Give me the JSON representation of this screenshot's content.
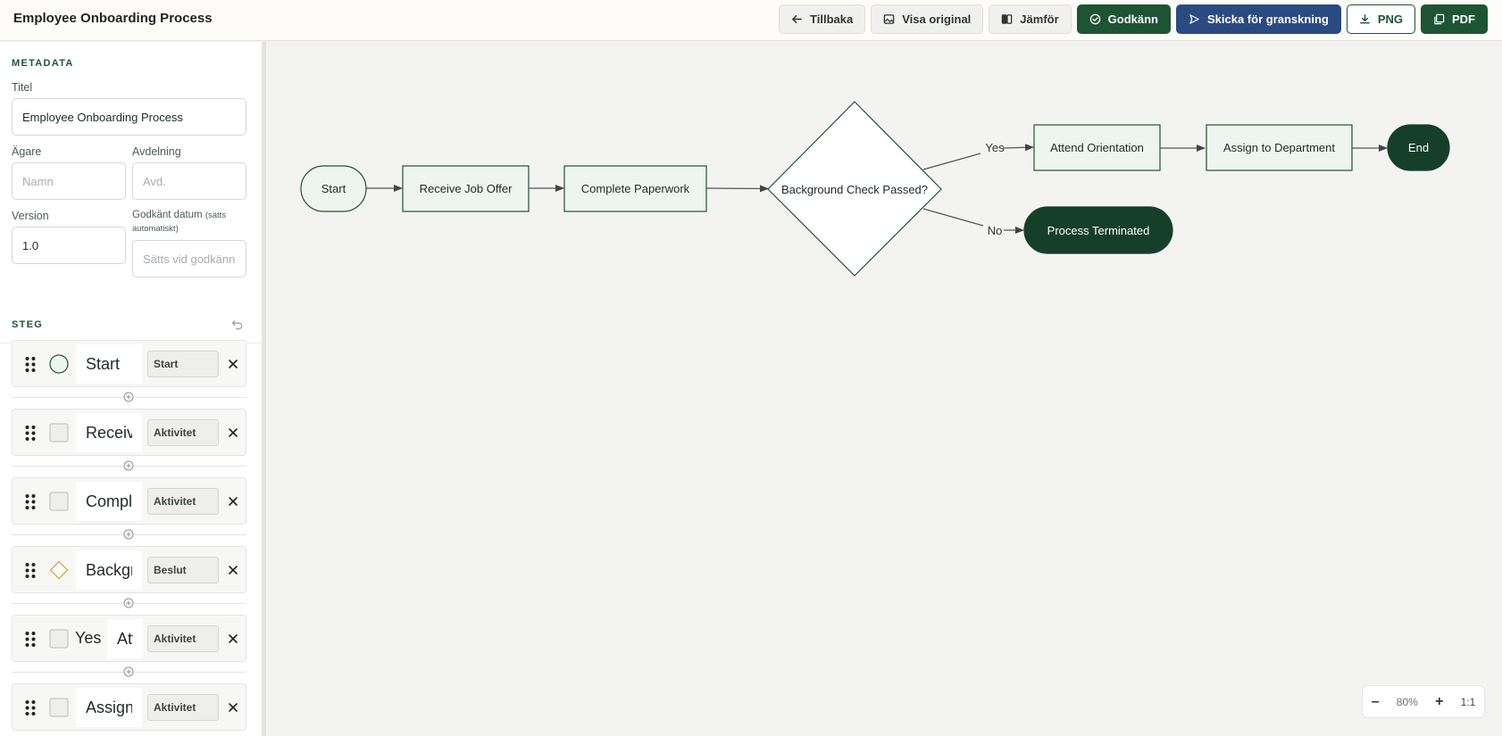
{
  "app": {
    "title": "Employee Onboarding Process"
  },
  "toolbar": {
    "back": "Tillbaka",
    "view_original": "Visa original",
    "compare": "Jämför",
    "approve": "Godkänn",
    "send_review": "Skicka för granskning",
    "png": "PNG",
    "pdf": "PDF"
  },
  "colors": {
    "brand_green": "#1d5434",
    "review_blue": "#2a4a82",
    "node_fill": "#eef5ef",
    "dark_node": "#163f2a",
    "decision_orange": "#d9a441"
  },
  "metadata": {
    "section_title": "METADATA",
    "title_label": "Titel",
    "title_value": "Employee Onboarding Process",
    "owner_label": "Ägare",
    "owner_placeholder": "Namn",
    "department_label": "Avdelning",
    "department_placeholder": "Avd.",
    "version_label": "Version",
    "version_value": "1.0",
    "approved_date_label": "Godkänt datum",
    "approved_date_hint": "(sätts automatiskt)",
    "approved_date_placeholder": "Sätts vid godkännande"
  },
  "steps": {
    "section_title": "STEG",
    "items": [
      {
        "name": "Start",
        "type": "Start",
        "shape": "circle-icon"
      },
      {
        "name": "Receive Job Offer",
        "type": "Aktivitet",
        "shape": "square-icon"
      },
      {
        "name": "Complete Paperwork",
        "type": "Aktivitet",
        "shape": "square-icon"
      },
      {
        "name": "Background Check Passed?",
        "type": "Beslut",
        "shape": "diamond-icon"
      },
      {
        "branch": "Yes",
        "name": "Attend Orientation",
        "type": "Aktivitet",
        "shape": "square-icon"
      },
      {
        "name": "Assign to Department",
        "type": "Aktivitet",
        "shape": "square-icon"
      }
    ]
  },
  "diagram": {
    "nodes": {
      "start": "Start",
      "receive": "Receive Job Offer",
      "paperwork": "Complete Paperwork",
      "decision": "Background Check Passed?",
      "orientation": "Attend Orientation",
      "assign": "Assign to Department",
      "end": "End",
      "terminated": "Process Terminated"
    },
    "edges": {
      "yes": "Yes",
      "no": "No"
    }
  },
  "zoom": {
    "minus": "–",
    "level": "80%",
    "plus": "+",
    "reset": "1:1"
  }
}
